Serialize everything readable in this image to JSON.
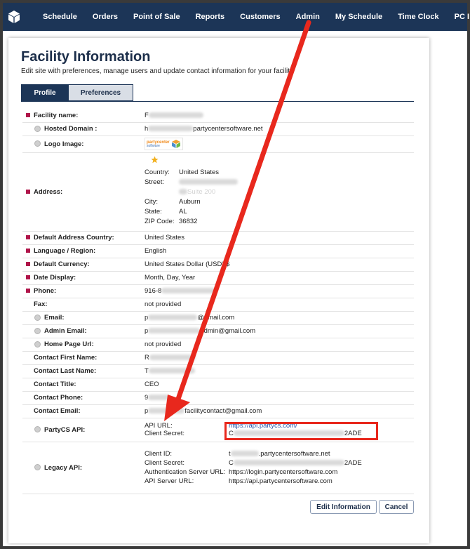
{
  "nav": {
    "items": [
      "Schedule",
      "Orders",
      "Point of Sale",
      "Reports",
      "Customers",
      "Admin",
      "My Schedule",
      "Time Clock",
      "PC I"
    ]
  },
  "page": {
    "title": "Facility Information",
    "subtitle": "Edit site with preferences, manage users and update contact information for your facility",
    "tabs": [
      "Profile",
      "Preferences"
    ]
  },
  "rows": {
    "facility_name": {
      "label": "Facility name:",
      "value": "F"
    },
    "hosted_domain": {
      "label": "Hosted Domain :",
      "value_prefix": "h",
      "value_suffix": "partycentersoftware.net"
    },
    "logo_image": {
      "label": "Logo Image:",
      "logo_text": "partycenter",
      "logo_sub": "software"
    },
    "address": {
      "label": "Address:",
      "country_label": "Country:",
      "country": "United States",
      "street_label": "Street:",
      "street2_suffix": "Suite 200",
      "city_label": "City:",
      "city": "Auburn",
      "state_label": "State:",
      "state": "AL",
      "zip_label": "ZIP Code:",
      "zip": "36832"
    },
    "default_address_country": {
      "label": "Default Address Country:",
      "value": "United States"
    },
    "language_region": {
      "label": "Language / Region:",
      "value": "English"
    },
    "default_currency": {
      "label": "Default Currency:",
      "value": "United States Dollar (USD) $"
    },
    "date_display": {
      "label": "Date Display:",
      "value": "Month, Day, Year"
    },
    "phone": {
      "label": "Phone:",
      "value_prefix": "916-8"
    },
    "fax": {
      "label": "Fax:",
      "value": "not provided"
    },
    "email": {
      "label": "Email:",
      "value_prefix": "p",
      "value_suffix": "@gmail.com"
    },
    "admin_email": {
      "label": "Admin Email:",
      "value_prefix": "p",
      "value_suffix": "admin@gmail.com"
    },
    "home_page_url": {
      "label": "Home Page Url:",
      "value": "not provided"
    },
    "contact_first_name": {
      "label": "Contact First Name:",
      "value_prefix": "R"
    },
    "contact_last_name": {
      "label": "Contact Last Name:",
      "value_prefix": "T"
    },
    "contact_title": {
      "label": "Contact Title:",
      "value": "CEO"
    },
    "contact_phone": {
      "label": "Contact Phone:",
      "value_prefix": "9"
    },
    "contact_email": {
      "label": "Contact Email:",
      "value_prefix": "p",
      "value_suffix": "facilitycontact@gmail.com"
    },
    "partycs_api": {
      "label": "PartyCS API:",
      "api_url_label": "API URL:",
      "api_url": "https://api.partycs.com/",
      "client_secret_label": "Client Secret:",
      "client_secret_prefix": "C",
      "client_secret_suffix": "2ADE"
    },
    "legacy_api": {
      "label": "Legacy API:",
      "client_id_label": "Client ID:",
      "client_id_prefix": "t",
      "client_id_suffix": ".partycentersoftware.net",
      "client_secret_label": "Client Secret:",
      "client_secret_prefix": "C",
      "client_secret_suffix": "2ADE",
      "auth_server_label": "Authentication Server URL:",
      "auth_server": "https://login.partycentersoftware.com",
      "api_server_label": "API Server URL:",
      "api_server": "https://api.partycentersoftware.com"
    }
  },
  "buttons": {
    "save": "Edit Information",
    "cancel": "Cancel"
  },
  "colors": {
    "nav": "#1c3557",
    "required": "#b0154a",
    "annotation": "#e8281d",
    "link": "#2a53a6"
  }
}
